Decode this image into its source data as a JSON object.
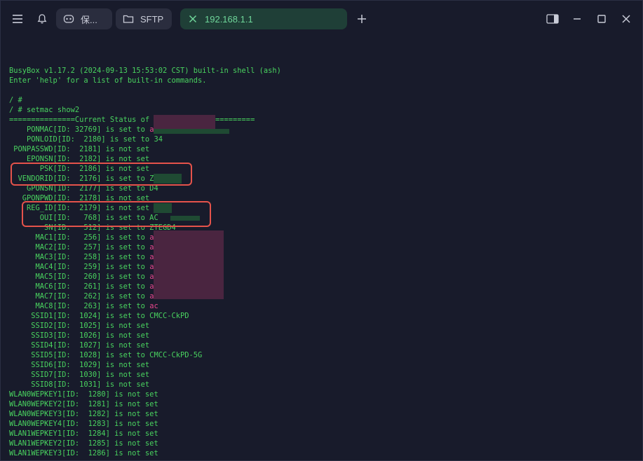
{
  "tabs": [
    {
      "label": "保..."
    },
    {
      "label": "SFTP"
    },
    {
      "label": "192.168.1.1"
    }
  ],
  "terminal": {
    "lines": [
      "",
      "BusyBox v1.17.2 (2024-09-13 15:53:02 CST) built-in shell (ash)",
      "Enter 'help' for a list of built-in commands.",
      "",
      "/ #",
      "/ # setmac show2",
      "===============Current Status of TagParam===============",
      "    PONMAC[ID: 32769] is set to ",
      "    PONLOID[ID:  2180] is set to 34",
      " PONPASSWD[ID:  2181] is not set",
      "    EPONSN[ID:  2182] is not set",
      "       PSK[ID:  2186] is not set",
      "  VENDORID[ID:  2176] is set to ZTEG",
      "    GPONSN[ID:  2177] is set to D4",
      "   GPONPWD[ID:  2178] is not set",
      "    REG_ID[ID:  2179] is not set",
      "       OUI[ID:   768] is set to AC",
      "        SN[ID:   512] is set to ZTEGD4",
      "      MAC1[ID:   256] is set to ",
      "      MAC2[ID:   257] is set to ",
      "      MAC3[ID:   258] is set to ",
      "      MAC4[ID:   259] is set to ",
      "      MAC5[ID:   260] is set to ",
      "      MAC6[ID:   261] is set to ",
      "      MAC7[ID:   262] is set to ",
      "      MAC8[ID:   263] is set to ",
      "     SSID1[ID:  1024] is set to CMCC-CkPD",
      "     SSID2[ID:  1025] is not set",
      "     SSID3[ID:  1026] is not set",
      "     SSID4[ID:  1027] is not set",
      "     SSID5[ID:  1028] is set to CMCC-CkPD-5G",
      "     SSID6[ID:  1029] is not set",
      "     SSID7[ID:  1030] is not set",
      "     SSID8[ID:  1031] is not set",
      "WLAN0WEPKEY1[ID:  1280] is not set",
      "WLAN0WEPKEY2[ID:  1281] is not set",
      "WLAN0WEPKEY3[ID:  1282] is not set",
      "WLAN0WEPKEY4[ID:  1283] is not set",
      "WLAN1WEPKEY1[ID:  1284] is not set",
      "WLAN1WEPKEY2[ID:  1285] is not set",
      "WLAN1WEPKEY3[ID:  1286] is not set"
    ],
    "mac_prefix": "ac",
    "colors": {
      "text": "#49d35f",
      "mac": "#e8468d",
      "highlight": "#e5534b"
    }
  },
  "icons": [
    "menu-icon",
    "bell-icon",
    "gamepad-icon",
    "folder-icon",
    "close-icon",
    "plus-icon",
    "sidebar-icon",
    "minimize-icon",
    "maximize-icon",
    "window-close-icon"
  ]
}
